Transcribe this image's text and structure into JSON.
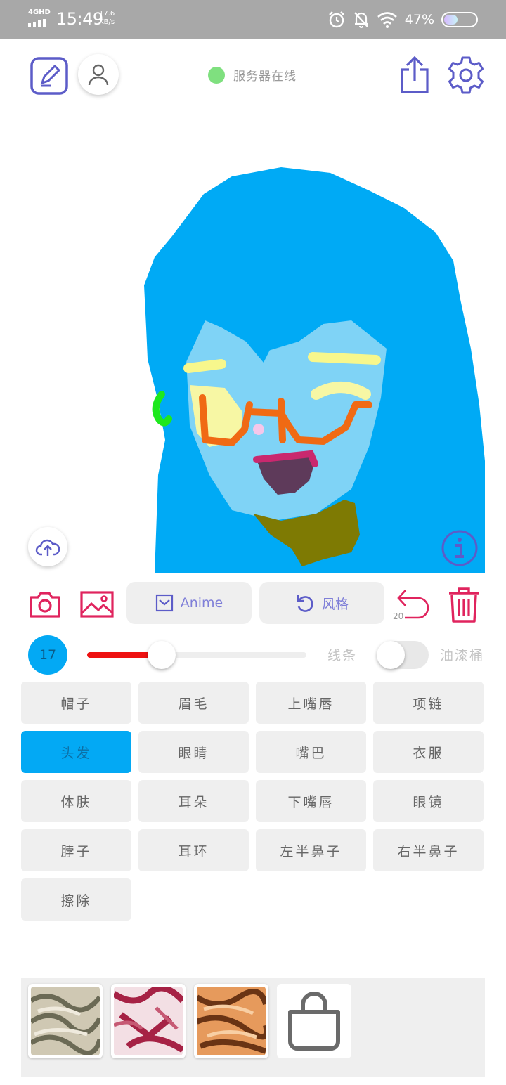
{
  "status_bar": {
    "network": "4GHD",
    "time": "15:49",
    "speed_value": "17.6",
    "speed_unit": "KB/s",
    "battery_percent": "47%",
    "icons": [
      "signal-icon",
      "alarm-icon",
      "bell-muted-icon",
      "wifi-icon",
      "battery-icon"
    ]
  },
  "toolbar": {
    "icons": [
      "edit-icon",
      "user-icon",
      "share-icon",
      "settings-icon",
      "coffee-icon"
    ],
    "server_status": "服务器在线",
    "server_color": "#7fe07f",
    "accent_color": "#5c5cc8"
  },
  "canvas": {
    "icons": [
      "cloud-upload-icon",
      "info-icon"
    ]
  },
  "tools": {
    "icons": [
      "camera-icon",
      "image-icon",
      "undo-icon",
      "trash-icon"
    ],
    "anime_label": "Anime",
    "style_label": "风格",
    "undo_count": "20",
    "tool_color": "#e0245e"
  },
  "brush": {
    "size": "17",
    "slider_fraction": 0.34,
    "line_label": "线条",
    "bucket_label": "油漆桶",
    "bucket_on": false
  },
  "parts": [
    {
      "label": "帽子",
      "active": false
    },
    {
      "label": "眉毛",
      "active": false
    },
    {
      "label": "上嘴唇",
      "active": false
    },
    {
      "label": "项链",
      "active": false
    },
    {
      "label": "头发",
      "active": true
    },
    {
      "label": "眼睛",
      "active": false
    },
    {
      "label": "嘴巴",
      "active": false
    },
    {
      "label": "衣服",
      "active": false
    },
    {
      "label": "体肤",
      "active": false
    },
    {
      "label": "耳朵",
      "active": false
    },
    {
      "label": "下嘴唇",
      "active": false
    },
    {
      "label": "眼镜",
      "active": false
    },
    {
      "label": "脖子",
      "active": false
    },
    {
      "label": "耳环",
      "active": false
    },
    {
      "label": "左半鼻子",
      "active": false
    },
    {
      "label": "右半鼻子",
      "active": false
    },
    {
      "label": "擦除",
      "active": false
    }
  ],
  "textures": {
    "items": [
      "texture-marble-grey",
      "texture-marble-red",
      "texture-marble-orange"
    ],
    "icons": [
      "shopping-bag-icon"
    ]
  }
}
